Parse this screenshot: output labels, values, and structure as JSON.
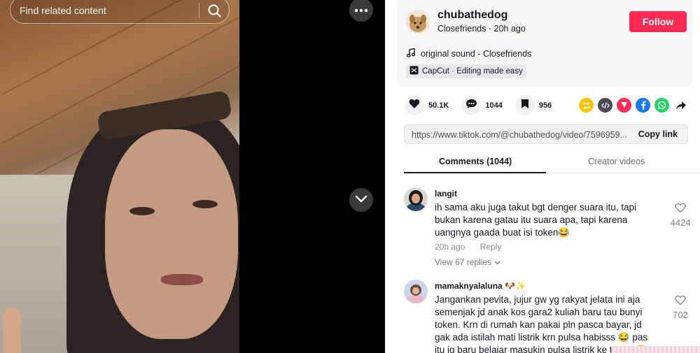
{
  "video": {
    "search": {
      "placeholder": "Find related content"
    },
    "icons": {
      "search": "search-icon",
      "more": "more-icon",
      "down": "chevron-down-icon"
    }
  },
  "post": {
    "username": "chubathedog",
    "nickname": "Closefriends",
    "separator": "·",
    "time_ago": "20h ago",
    "follow_label": "Follow",
    "sound": "original sound - Closefriends",
    "capcut": "CapCut · Editing made easy"
  },
  "stats": {
    "likes": "50.1K",
    "comments": "1044",
    "saves": "956"
  },
  "share": {
    "icons": [
      "repost-icon",
      "embed-icon",
      "send-icon",
      "facebook-icon",
      "whatsapp-icon",
      "share-arrow-icon"
    ],
    "colors": {
      "repost": "#ffc300",
      "embed": "#4b4b55",
      "send": "#fe2c55",
      "facebook": "#1877f2",
      "whatsapp": "#25d366"
    }
  },
  "link": {
    "url": "https://www.tiktok.com/@chubathedog/video/7596959...",
    "copy_label": "Copy link"
  },
  "tabs": {
    "comments": "Comments (1044)",
    "creator": "Creator videos"
  },
  "comments": [
    {
      "user": "langit",
      "text": "ih sama aku juga takut bgt denger suara itu, tapi bukan karena gatau itu suara apa, tapi karena uangnya gaada buat isi token😂",
      "time": "20h ago",
      "reply": "Reply",
      "view_replies": "View 67 replies",
      "likes": "4424"
    },
    {
      "user": "mamaknyalaluna 🐶✨",
      "text": "Jangankan pevita, jujur gw yg rakyat jelata ini aja semenjak jd anak kos gara2 kuliah baru tau bunyi token. Krn di rumah kan pakai pln pasca bayar, jd gak ada istilah mati listrik krn pulsa habisss 😂 pas itu jg baru belajar masukin pulsa listrik ke token 😂",
      "likes": "702"
    }
  ],
  "colors": {
    "accent": "#fe2c55",
    "text": "#161823"
  }
}
